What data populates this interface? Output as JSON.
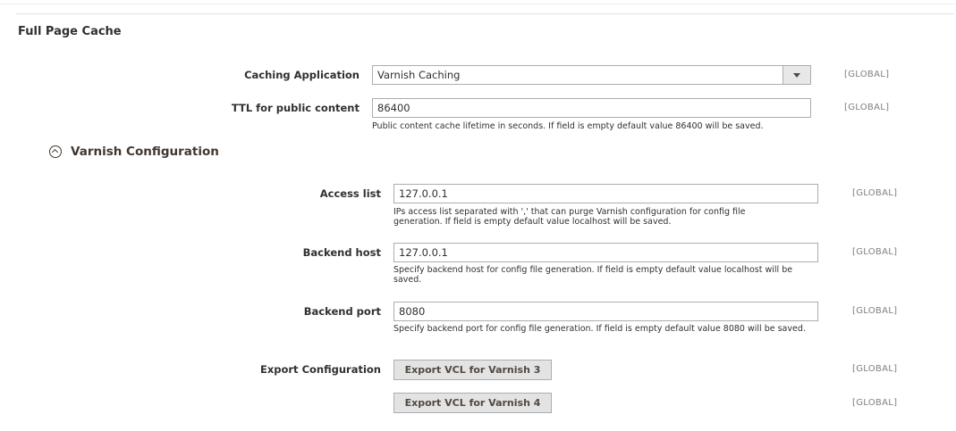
{
  "section": {
    "title": "Full Page Cache"
  },
  "caching_application": {
    "label": "Caching Application",
    "value": "Varnish Caching",
    "scope": "[GLOBAL]"
  },
  "ttl": {
    "label": "TTL for public content",
    "value": "86400",
    "note": "Public content cache lifetime in seconds. If field is empty default value 86400 will be saved.",
    "scope": "[GLOBAL]"
  },
  "varnish_group": {
    "title": "Varnish Configuration"
  },
  "access_list": {
    "label": "Access list",
    "value": "127.0.0.1",
    "note": "IPs access list separated with ',' that can purge Varnish configuration for config file generation. If field is empty default value localhost will be saved.",
    "scope": "[GLOBAL]"
  },
  "backend_host": {
    "label": "Backend host",
    "value": "127.0.0.1",
    "note": "Specify backend host for config file generation. If field is empty default value localhost will be saved.",
    "scope": "[GLOBAL]"
  },
  "backend_port": {
    "label": "Backend port",
    "value": "8080",
    "note": "Specify backend port for config file generation. If field is empty default value 8080 will be saved.",
    "scope": "[GLOBAL]"
  },
  "export": {
    "label": "Export Configuration",
    "button_v3": "Export VCL for Varnish 3",
    "button_v4": "Export VCL for Varnish 4",
    "scope_v3": "[GLOBAL]",
    "scope_v4": "[GLOBAL]"
  }
}
